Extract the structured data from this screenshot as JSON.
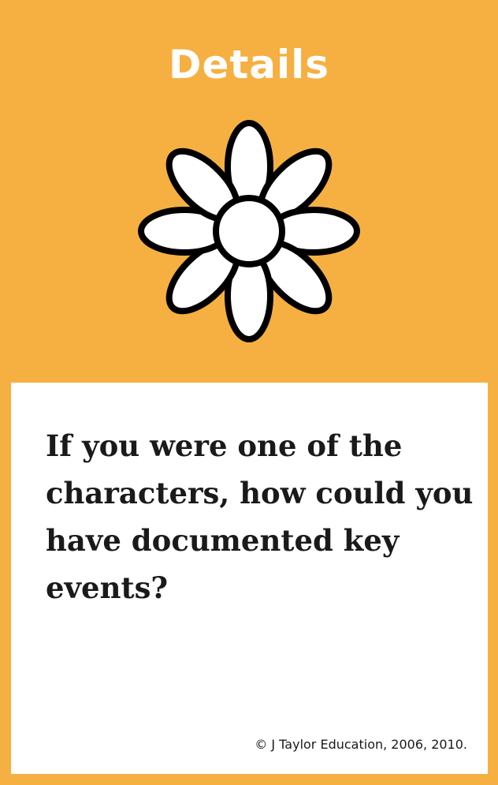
{
  "card": {
    "title": "Details",
    "icon": "daisy-flower-icon",
    "question": "If you were one of the characters, how could you have documented key events?",
    "copyright": "© J Taylor Education, 2006, 2010."
  },
  "colors": {
    "background": "#f5b041",
    "panel": "#ffffff",
    "text": "#1a1a1a",
    "title": "#ffffff"
  }
}
